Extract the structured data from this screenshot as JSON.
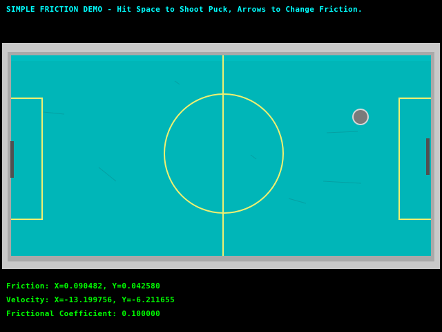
{
  "header": {
    "title": "SIMPLE FRICTION DEMO - Hit Space to Shoot Puck, Arrows to Change Friction."
  },
  "status": {
    "friction": "Friction: X=0.090482, Y=0.042580",
    "velocity": "Velocity: X=-13.199756, Y=-6.211655",
    "coefficient": "Frictional Coefficient: 0.100000"
  },
  "colors": {
    "background": "#000000",
    "title_text": "#00ffff",
    "status_text": "#00ff00",
    "table_frame": "#c8c8c8",
    "ice": "#00b6b8",
    "lines": "#f0f070",
    "puck": "#7a7a7a",
    "puck_rim": "#d8d8d8",
    "goal": "#505050"
  },
  "icons": {
    "puck": "puck-icon",
    "goal_left": "goal-left-icon",
    "goal_right": "goal-right-icon"
  }
}
